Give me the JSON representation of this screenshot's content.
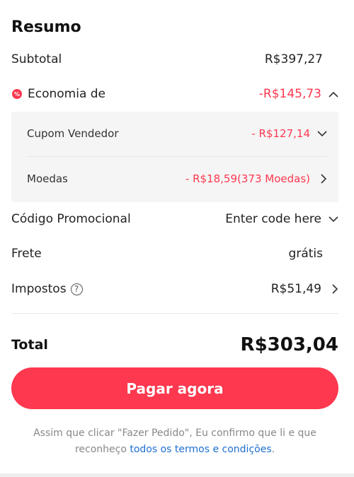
{
  "summary": {
    "title": "Resumo",
    "subtotal": {
      "label": "Subtotal",
      "value": "R$397,27"
    },
    "savings": {
      "icon": "percent-badge-icon",
      "label": "Economia de",
      "value": "-R$145,73",
      "expanded": true,
      "items": [
        {
          "label": "Cupom Vendedor",
          "value": "- R$127,14",
          "icon": "chevron-down-icon"
        },
        {
          "label": "Moedas",
          "value": "- R$18,59(373 Moedas)",
          "icon": "chevron-right-icon"
        }
      ]
    },
    "promo": {
      "label": "Código Promocional",
      "value": "Enter code here"
    },
    "shipping": {
      "label": "Frete",
      "value": "grátis"
    },
    "taxes": {
      "label": "Impostos",
      "help_symbol": "?",
      "value": "R$51,49"
    },
    "total": {
      "label": "Total",
      "value": "R$303,04"
    },
    "pay_button": "Pagar agora",
    "disclaimer": {
      "text": "Assim que clicar \"Fazer Pedido\", Eu confirmo que li e que reconheço ",
      "link": "todos os termos e condições",
      "end": "."
    }
  },
  "colors": {
    "accent": "#fd384f",
    "link": "#1f6fd0",
    "muted": "#888888",
    "panel_bg": "#f5f5f5"
  }
}
